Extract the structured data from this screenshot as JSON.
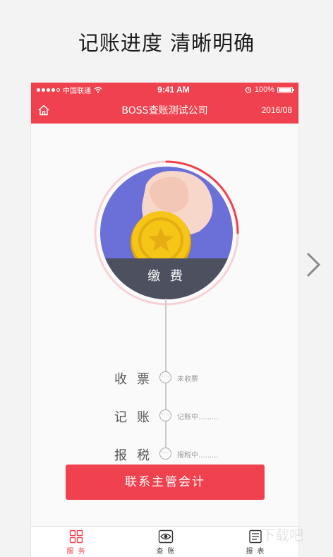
{
  "headline": "记账进度 清晰明确",
  "status_bar": {
    "carrier": "中国联通",
    "time": "9:41 AM",
    "battery": "100%"
  },
  "nav": {
    "title": "BOSS查账测试公司",
    "date": "2016/08",
    "home_icon": "home-icon"
  },
  "hero": {
    "pay_label": "缴 费",
    "icon": "coin-star-icon"
  },
  "steps": [
    {
      "label": "收票",
      "status": "未收票",
      "node": "····"
    },
    {
      "label": "记账",
      "status": "记账中.........",
      "node": "····"
    },
    {
      "label": "报税",
      "status": "报税中.........",
      "node": "····"
    }
  ],
  "contact_button": "联系主管会计",
  "tabs": [
    {
      "label": "服务",
      "icon": "grid-icon",
      "active": true
    },
    {
      "label": "查账",
      "icon": "eye-icon",
      "active": false
    },
    {
      "label": "报表",
      "icon": "report-icon",
      "active": false
    }
  ],
  "watermark": "下载吧",
  "colors": {
    "brand_red": "#f0424e",
    "hero_purple": "#6b6fd8",
    "band_dark": "#4d505e",
    "coin_gold": "#f5c518"
  }
}
